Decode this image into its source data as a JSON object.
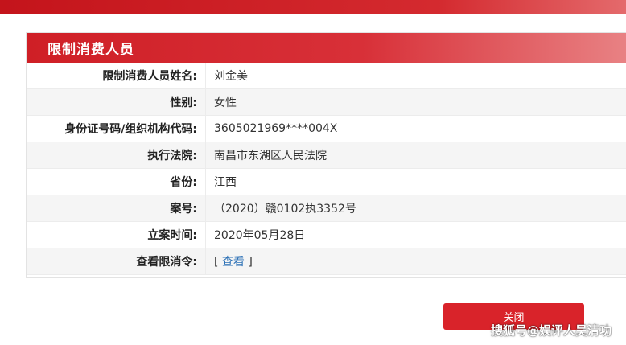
{
  "panel": {
    "title": "限制消费人员"
  },
  "rows": [
    {
      "label": "限制消费人员姓名:",
      "value": "刘金美"
    },
    {
      "label": "性别:",
      "value": "女性"
    },
    {
      "label": "身份证号码/组织机构代码:",
      "value": "3605021969****004X"
    },
    {
      "label": "执行法院:",
      "value": "南昌市东湖区人民法院"
    },
    {
      "label": "省份:",
      "value": "江西"
    },
    {
      "label": "案号:",
      "value": "（2020）赣0102执3352号"
    },
    {
      "label": "立案时间:",
      "value": "2020年05月28日"
    },
    {
      "label": "查看限消令:",
      "link_open": "[ ",
      "link_text": "查看",
      "link_close": " ]"
    }
  ],
  "close_button": {
    "label": "关闭"
  },
  "watermark": "搜狐号@娱评人吴清功"
}
